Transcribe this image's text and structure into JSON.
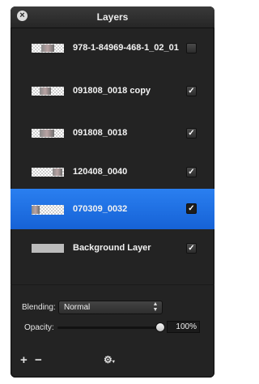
{
  "panel": {
    "title": "Layers",
    "close_icon": "close-icon"
  },
  "layers": [
    {
      "name": "978-1-84969-468-1_02_01",
      "visible": false,
      "selected": false
    },
    {
      "name": "091808_0018 copy",
      "visible": true,
      "selected": false
    },
    {
      "name": "091808_0018",
      "visible": true,
      "selected": false
    },
    {
      "name": "120408_0040",
      "visible": true,
      "selected": false
    },
    {
      "name": "070309_0032",
      "visible": true,
      "selected": true
    },
    {
      "name": "Background Layer",
      "visible": true,
      "selected": false
    }
  ],
  "blending": {
    "label": "Blending:",
    "value": "Normal"
  },
  "opacity": {
    "label": "Opacity:",
    "value": "100%",
    "level": 1.0
  },
  "toolbar": {
    "add_label": "+",
    "remove_label": "−",
    "gear_label": "⚙",
    "gear_caret": "▾"
  },
  "colors": {
    "panel_bg": "#232323",
    "selection": "#1c6ce0",
    "text": "#f2f2f2"
  }
}
